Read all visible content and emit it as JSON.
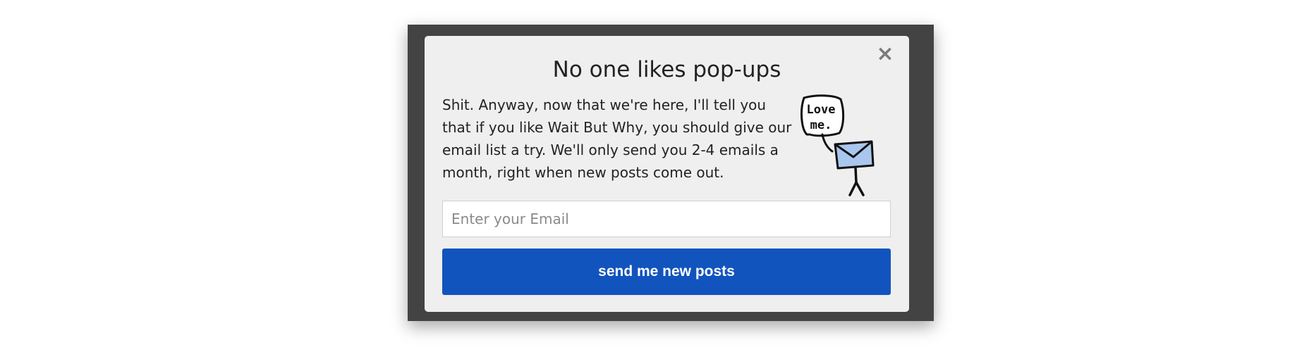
{
  "popup": {
    "close_glyph": "×",
    "title": "No one likes pop-ups",
    "body": "Shit. Anyway, now that we're here, I'll tell you that if you like Wait But Why, you should give our email list a try. We'll only send you 2-4 emails a month, right when new posts come out.",
    "speech_bubble_text": [
      "Love",
      "me."
    ],
    "email_placeholder": "Enter your Email",
    "email_value": "",
    "submit_label": "send me new posts"
  },
  "colors": {
    "frame": "#434343",
    "popup_bg": "#efefef",
    "button": "#1254be",
    "envelope": "#a9c7ee"
  },
  "icons": {
    "close": "close-icon",
    "illustration": "stickman-envelope-icon"
  }
}
